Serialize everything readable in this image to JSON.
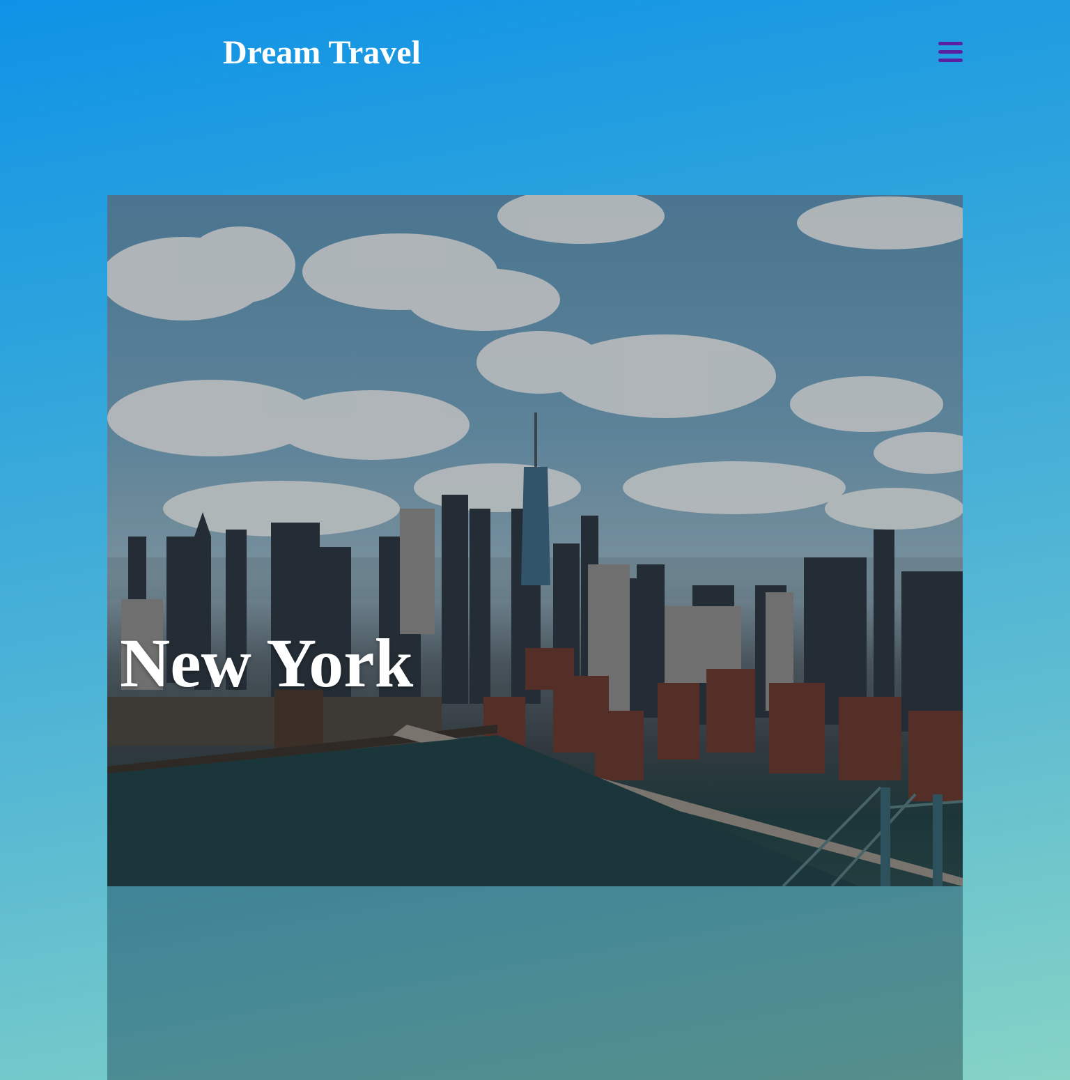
{
  "header": {
    "site_title": "Dream Travel",
    "menu_icon": "hamburger-menu-icon"
  },
  "destination": {
    "title": "New York",
    "image_subject": "manhattan-skyline-photo"
  },
  "colors": {
    "menu_icon": "#5b1fa2",
    "title_text": "#ffffff",
    "background_top": "#0f92e6",
    "background_bottom": "#86d3c6"
  }
}
